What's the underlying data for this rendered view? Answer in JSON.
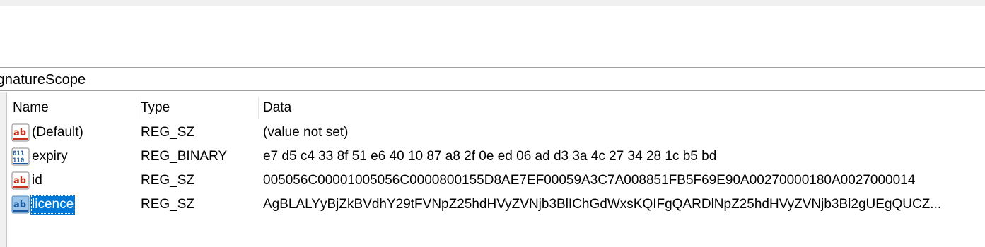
{
  "address": {
    "path": "ignatureScope"
  },
  "columns": {
    "name": "Name",
    "type": "Type",
    "data": "Data"
  },
  "values": [
    {
      "name": "(Default)",
      "type": "REG_SZ",
      "data": "(value not set)",
      "icon": "string-value-icon"
    },
    {
      "name": "expiry",
      "type": "REG_BINARY",
      "data": "e7 d5 c4 33 8f 51 e6 40 10 87 a8 2f 0e ed 06 ad d3 3a 4c 27 34 28 1c b5 bd",
      "icon": "binary-value-icon"
    },
    {
      "name": "id",
      "type": "REG_SZ",
      "data": "005056C00001005056C0000800155D8AE7EF00059A3C7A008851FB5F69E90A00270000180A0027000014",
      "icon": "string-value-icon"
    },
    {
      "name": "licence",
      "type": "REG_SZ",
      "data": "AgBLALYyBjZkBVdhY29tFVNpZ25hdHVyZVNjb3BlIChGdWxsKQIFgQARDlNpZ25hdHVyZVNjb3Bl2gUEgQUCZ...",
      "icon": "string-value-icon",
      "selected": true
    }
  ],
  "colors": {
    "selection": "#0078d7",
    "string_icon_red": "#c8321e",
    "binary_icon_blue": "#1e5aa0"
  }
}
